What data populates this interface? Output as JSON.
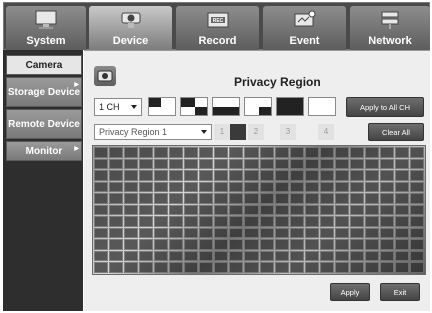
{
  "top_nav": {
    "tabs": [
      {
        "label": "System",
        "icon": "monitor-icon",
        "active": false
      },
      {
        "label": "Device",
        "icon": "camera-icon",
        "active": true
      },
      {
        "label": "Record",
        "icon": "record-icon",
        "active": false
      },
      {
        "label": "Event",
        "icon": "event-icon",
        "active": false
      },
      {
        "label": "Network",
        "icon": "network-icon",
        "active": false
      }
    ]
  },
  "sidebar": {
    "items": [
      {
        "label": "Camera",
        "active": true
      },
      {
        "label": "Storage Device",
        "active": false
      },
      {
        "label": "Remote Device",
        "active": false
      },
      {
        "label": "Monitor",
        "active": false
      }
    ]
  },
  "main": {
    "title": "Privacy Region",
    "title_icon": "camera-settings-icon",
    "channel_select": {
      "value": "1 CH"
    },
    "mask_pattern_buttons": [
      "top-left-pattern",
      "top-right-pattern",
      "bottom-left-pattern",
      "bottom-right-pattern",
      "all-pattern",
      "none-pattern"
    ],
    "apply_all_label": "Apply to All CH",
    "region_select": {
      "value": "Privacy Region 1"
    },
    "region_numbers": [
      "1",
      "2",
      "3",
      "4"
    ],
    "selected_region_index": 1,
    "clear_all_label": "Clear All",
    "apply_label": "Apply",
    "exit_label": "Exit"
  },
  "colors": {
    "topbar": "#4a4a4a",
    "sidebar": "#2e2e2e",
    "panel": "#eeeeee",
    "button": "#555555",
    "mask_cell": "#333333"
  }
}
